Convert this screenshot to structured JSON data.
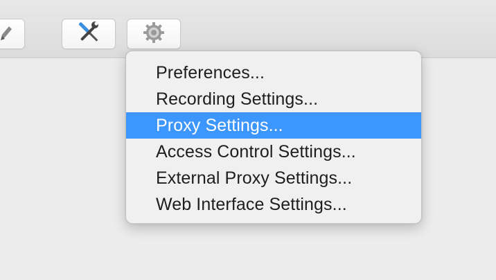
{
  "toolbar": {
    "buttons": [
      {
        "name": "pencil-button",
        "icon": "pencil-icon"
      },
      {
        "name": "tools-button",
        "icon": "tools-icon"
      },
      {
        "name": "settings-button",
        "icon": "gear-icon"
      }
    ]
  },
  "menu": {
    "selected_index": 2,
    "items": [
      {
        "label": "Preferences..."
      },
      {
        "label": "Recording Settings..."
      },
      {
        "label": "Proxy Settings..."
      },
      {
        "label": "Access Control Settings..."
      },
      {
        "label": "External Proxy Settings..."
      },
      {
        "label": "Web Interface Settings..."
      }
    ]
  },
  "colors": {
    "selection": "#3d96fc",
    "menu_background": "#f0f0f0",
    "window_background": "#ececec"
  }
}
